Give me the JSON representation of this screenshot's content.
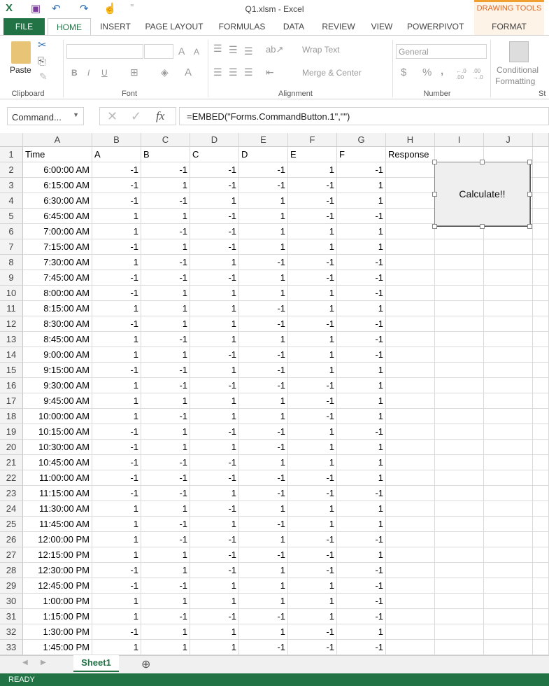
{
  "window": {
    "title": "Q1.xlsm - Excel",
    "context_group": "DRAWING TOOLS"
  },
  "tabs": [
    "FILE",
    "HOME",
    "INSERT",
    "PAGE LAYOUT",
    "FORMULAS",
    "DATA",
    "REVIEW",
    "VIEW",
    "POWERPIVOT",
    "FORMAT"
  ],
  "ribbon": {
    "paste": "Paste",
    "clipboard": "Clipboard",
    "font": "Font",
    "alignment": "Alignment",
    "number": "Number",
    "wrap_text": "Wrap Text",
    "merge_center": "Merge & Center",
    "number_format": "General",
    "conditional1": "Conditional",
    "conditional2": "Formatting",
    "styles_partial": "St",
    "bold": "B",
    "italic": "I",
    "underline": "U",
    "currency": "$",
    "percent": "%",
    "comma": ",",
    "inc_dec": "←.0 .00",
    "dec_dec": ".00 →.0",
    "grow": "A",
    "shrink": "A",
    "font_color": "A"
  },
  "formula_bar": {
    "name_box": "Command...",
    "formula": "=EMBED(\"Forms.CommandButton.1\",\"\")",
    "fx": "fx",
    "cancel": "✕",
    "enter": "✓"
  },
  "columns": [
    "A",
    "B",
    "C",
    "D",
    "E",
    "F",
    "G",
    "H",
    "I",
    "J"
  ],
  "header_row": [
    "Time",
    "A",
    "B",
    "C",
    "D",
    "E",
    "F",
    "Response"
  ],
  "rows": [
    {
      "n": "2",
      "time": "6:00:00 AM",
      "v": [
        -1,
        -1,
        -1,
        -1,
        1,
        -1
      ]
    },
    {
      "n": "3",
      "time": "6:15:00 AM",
      "v": [
        -1,
        1,
        -1,
        -1,
        -1,
        1
      ]
    },
    {
      "n": "4",
      "time": "6:30:00 AM",
      "v": [
        -1,
        -1,
        1,
        1,
        -1,
        1
      ]
    },
    {
      "n": "5",
      "time": "6:45:00 AM",
      "v": [
        1,
        1,
        -1,
        1,
        -1,
        -1
      ]
    },
    {
      "n": "6",
      "time": "7:00:00 AM",
      "v": [
        1,
        -1,
        -1,
        1,
        1,
        1
      ]
    },
    {
      "n": "7",
      "time": "7:15:00 AM",
      "v": [
        -1,
        1,
        -1,
        1,
        1,
        1
      ]
    },
    {
      "n": "8",
      "time": "7:30:00 AM",
      "v": [
        1,
        -1,
        1,
        -1,
        -1,
        -1
      ]
    },
    {
      "n": "9",
      "time": "7:45:00 AM",
      "v": [
        -1,
        -1,
        -1,
        1,
        -1,
        -1
      ]
    },
    {
      "n": "10",
      "time": "8:00:00 AM",
      "v": [
        -1,
        1,
        1,
        1,
        1,
        -1
      ]
    },
    {
      "n": "11",
      "time": "8:15:00 AM",
      "v": [
        1,
        1,
        1,
        -1,
        1,
        1
      ]
    },
    {
      "n": "12",
      "time": "8:30:00 AM",
      "v": [
        -1,
        1,
        1,
        -1,
        -1,
        -1
      ]
    },
    {
      "n": "13",
      "time": "8:45:00 AM",
      "v": [
        1,
        -1,
        1,
        1,
        1,
        -1
      ]
    },
    {
      "n": "14",
      "time": "9:00:00 AM",
      "v": [
        1,
        1,
        -1,
        -1,
        1,
        -1
      ]
    },
    {
      "n": "15",
      "time": "9:15:00 AM",
      "v": [
        -1,
        -1,
        1,
        -1,
        1,
        1
      ]
    },
    {
      "n": "16",
      "time": "9:30:00 AM",
      "v": [
        1,
        -1,
        -1,
        -1,
        -1,
        1
      ]
    },
    {
      "n": "17",
      "time": "9:45:00 AM",
      "v": [
        1,
        1,
        1,
        1,
        -1,
        1
      ]
    },
    {
      "n": "18",
      "time": "10:00:00 AM",
      "v": [
        1,
        -1,
        1,
        1,
        -1,
        1
      ]
    },
    {
      "n": "19",
      "time": "10:15:00 AM",
      "v": [
        -1,
        1,
        -1,
        -1,
        1,
        -1
      ]
    },
    {
      "n": "20",
      "time": "10:30:00 AM",
      "v": [
        -1,
        1,
        1,
        -1,
        1,
        1
      ]
    },
    {
      "n": "21",
      "time": "10:45:00 AM",
      "v": [
        -1,
        -1,
        -1,
        1,
        1,
        1
      ]
    },
    {
      "n": "22",
      "time": "11:00:00 AM",
      "v": [
        -1,
        -1,
        -1,
        -1,
        -1,
        1
      ]
    },
    {
      "n": "23",
      "time": "11:15:00 AM",
      "v": [
        -1,
        -1,
        1,
        -1,
        -1,
        -1
      ]
    },
    {
      "n": "24",
      "time": "11:30:00 AM",
      "v": [
        1,
        1,
        -1,
        1,
        1,
        1
      ]
    },
    {
      "n": "25",
      "time": "11:45:00 AM",
      "v": [
        1,
        -1,
        1,
        -1,
        1,
        1
      ]
    },
    {
      "n": "26",
      "time": "12:00:00 PM",
      "v": [
        1,
        -1,
        -1,
        1,
        -1,
        -1
      ]
    },
    {
      "n": "27",
      "time": "12:15:00 PM",
      "v": [
        1,
        1,
        -1,
        -1,
        -1,
        1
      ]
    },
    {
      "n": "28",
      "time": "12:30:00 PM",
      "v": [
        -1,
        1,
        -1,
        1,
        -1,
        -1
      ]
    },
    {
      "n": "29",
      "time": "12:45:00 PM",
      "v": [
        -1,
        -1,
        1,
        1,
        1,
        -1
      ]
    },
    {
      "n": "30",
      "time": "1:00:00 PM",
      "v": [
        1,
        1,
        1,
        1,
        1,
        -1
      ]
    },
    {
      "n": "31",
      "time": "1:15:00 PM",
      "v": [
        1,
        -1,
        -1,
        -1,
        1,
        -1
      ]
    },
    {
      "n": "32",
      "time": "1:30:00 PM",
      "v": [
        -1,
        1,
        1,
        1,
        -1,
        1
      ]
    },
    {
      "n": "33",
      "time": "1:45:00 PM",
      "v": [
        1,
        1,
        1,
        -1,
        -1,
        -1
      ]
    }
  ],
  "embedded_button": {
    "label": "Calculate!!"
  },
  "sheet_tabs": {
    "active": "Sheet1",
    "add": "⊕"
  },
  "status": {
    "text": "READY"
  },
  "colors": {
    "excel_green": "#217346",
    "drawing_tools": "#d9692a"
  }
}
